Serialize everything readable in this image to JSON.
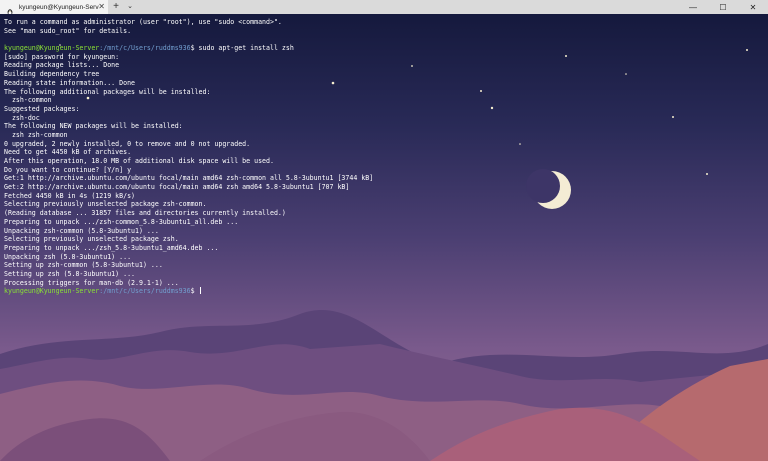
{
  "window": {
    "tab_title": "kyungeun@Kyungeun-Server: /",
    "tab_close": "✕",
    "new_tab": "+",
    "dropdown": "⌄",
    "minimize": "—",
    "maximize": "☐",
    "close": "✕"
  },
  "terminal": {
    "lines": [
      {
        "text": "To run a command as administrator (user \"root\"), use \"sudo <command>\"."
      },
      {
        "text": "See \"man sudo_root\" for details."
      },
      {
        "text": ""
      },
      {
        "user": "kyungeun@Kyungeun-Server",
        "path": ":/mnt/c/Users/ruddms936",
        "cmd": "$ sudo apt-get install zsh"
      },
      {
        "text": "[sudo] password for kyungeun:"
      },
      {
        "text": "Reading package lists... Done"
      },
      {
        "text": "Building dependency tree"
      },
      {
        "text": "Reading state information... Done"
      },
      {
        "text": "The following additional packages will be installed:"
      },
      {
        "text": "  zsh-common"
      },
      {
        "text": "Suggested packages:"
      },
      {
        "text": "  zsh-doc"
      },
      {
        "text": "The following NEW packages will be installed:"
      },
      {
        "text": "  zsh zsh-common"
      },
      {
        "text": "0 upgraded, 2 newly installed, 0 to remove and 0 not upgraded."
      },
      {
        "text": "Need to get 4450 kB of archives."
      },
      {
        "text": "After this operation, 18.0 MB of additional disk space will be used."
      },
      {
        "text": "Do you want to continue? [Y/n] y"
      },
      {
        "text": "Get:1 http://archive.ubuntu.com/ubuntu focal/main amd64 zsh-common all 5.8-3ubuntu1 [3744 kB]"
      },
      {
        "text": "Get:2 http://archive.ubuntu.com/ubuntu focal/main amd64 zsh amd64 5.8-3ubuntu1 [707 kB]"
      },
      {
        "text": "Fetched 4450 kB in 4s (1219 kB/s)"
      },
      {
        "text": "Selecting previously unselected package zsh-common."
      },
      {
        "text": "(Reading database ... 31857 files and directories currently installed.)"
      },
      {
        "text": "Preparing to unpack .../zsh-common_5.8-3ubuntu1_all.deb ..."
      },
      {
        "text": "Unpacking zsh-common (5.8-3ubuntu1) ..."
      },
      {
        "text": "Selecting previously unselected package zsh."
      },
      {
        "text": "Preparing to unpack .../zsh_5.8-3ubuntu1_amd64.deb ..."
      },
      {
        "text": "Unpacking zsh (5.8-3ubuntu1) ..."
      },
      {
        "text": "Setting up zsh-common (5.8-3ubuntu1) ..."
      },
      {
        "text": "Setting up zsh (5.8-3ubuntu1) ..."
      },
      {
        "text": "Processing triggers for man-db (2.9.1-1) ..."
      },
      {
        "user": "kyungeun@Kyungeun-Server",
        "path": ":/mnt/c/Users/ruddms936",
        "cmd": "$ ",
        "cursor": true
      }
    ]
  },
  "colors": {
    "prompt_user": "#8ae234",
    "prompt_path": "#729fcf",
    "text": "#ffffff"
  }
}
